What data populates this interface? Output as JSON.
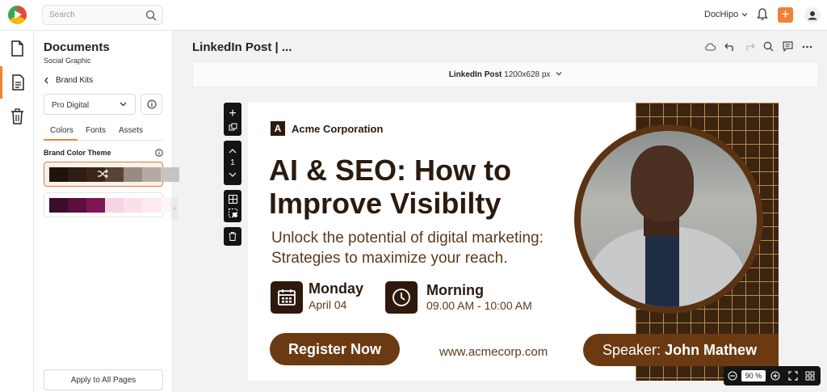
{
  "app": {
    "name": "DocHipo"
  },
  "topbar": {
    "search_placeholder": "Search",
    "account_label": "DocHipo",
    "icons": [
      "search-icon",
      "chevron-down-icon",
      "bell-icon",
      "plus-icon",
      "user-icon"
    ],
    "accent": "#f08236"
  },
  "rail": {
    "items": [
      "document-icon",
      "page-icon",
      "trash-icon"
    ]
  },
  "panel": {
    "title": "Documents",
    "subtitle": "Social Graphic",
    "back_label": "Brand Kits",
    "kit_selected": "Pro Digital",
    "tabs": [
      "Colors",
      "Fonts",
      "Assets"
    ],
    "theme_label": "Brand Color Theme",
    "palettes": [
      {
        "colors": [
          "#1f140c",
          "#2e1d12",
          "#3b2616",
          "#574434",
          "#9a8b80",
          "#b3aaa4",
          "#c4c4c4"
        ]
      },
      {
        "colors": [
          "#3a0d2b",
          "#5a0f3f",
          "#7d1655",
          "#f8d3e3",
          "#fbe0ec",
          "#fdeaf3",
          "#fff4f9"
        ]
      }
    ],
    "apply_label": "Apply to All Pages"
  },
  "editor": {
    "doc_title": "LinkedIn Post | ...",
    "size_name": "LinkedIn Post",
    "size_dims": "1200x628 px",
    "page_number": "1",
    "zoom": "90 %"
  },
  "design": {
    "company": "Acme Corporation",
    "logo_letter": "A",
    "headline": "AI & SEO: How to Improve Visibilty",
    "subline": "Unlock the potential of digital marketing: Strategies to maximize your reach.",
    "event_day_title": "Monday",
    "event_day_sub": "April 04",
    "event_time_title": "Morning",
    "event_time_sub": "09.00 AM - 10:00 AM",
    "cta": "Register Now",
    "url": "www.acmecorp.com",
    "speaker_label": "Speaker:",
    "speaker_name": "John Mathew",
    "colors": {
      "dark_brown": "#2b1a0d",
      "brown": "#6b3a12",
      "grid": "#b88a4d"
    }
  }
}
